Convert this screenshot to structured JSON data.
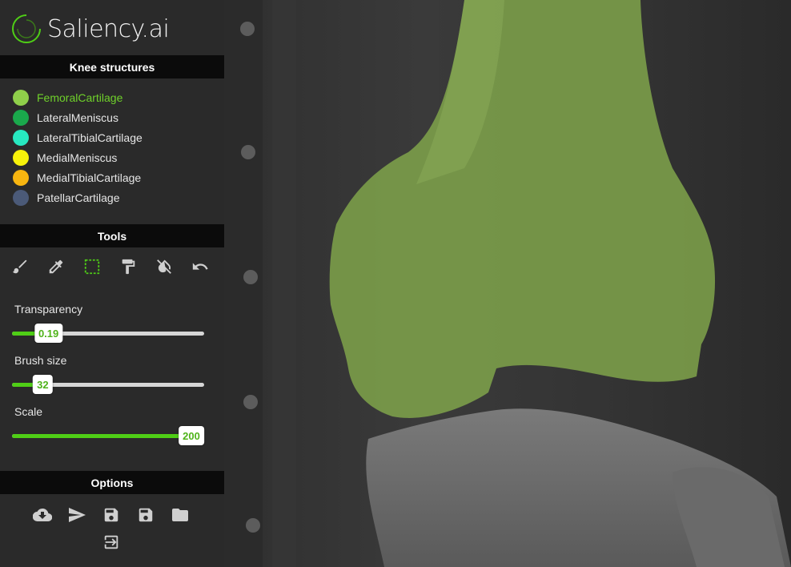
{
  "app": {
    "logo_text": "Saliency.ai"
  },
  "structures": {
    "header": "Knee structures",
    "items": [
      {
        "label": "FemoralCartilage",
        "color": "#8fcf4a",
        "active": true
      },
      {
        "label": "LateralMeniscus",
        "color": "#1aa84c",
        "active": false
      },
      {
        "label": "LateralTibialCartilage",
        "color": "#27e8c0",
        "active": false
      },
      {
        "label": "MedialMeniscus",
        "color": "#f7f20a",
        "active": false
      },
      {
        "label": "MedialTibialCartilage",
        "color": "#f7b510",
        "active": false
      },
      {
        "label": "PatellarCartilage",
        "color": "#4b5a78",
        "active": false
      }
    ]
  },
  "tools": {
    "header": "Tools",
    "items": [
      "brush-icon",
      "eyedropper-icon",
      "selection-icon",
      "paint-roller-icon",
      "fill-off-icon",
      "undo-icon"
    ],
    "active": "selection-icon"
  },
  "sliders": {
    "transparency": {
      "label": "Transparency",
      "value": "0.19",
      "fraction": 0.19
    },
    "brush_size": {
      "label": "Brush size",
      "value": "32",
      "fraction": 0.16
    },
    "scale": {
      "label": "Scale",
      "value": "200",
      "fraction": 1.0
    }
  },
  "options": {
    "header": "Options",
    "items": [
      "cloud-download-icon",
      "send-icon",
      "save-icon",
      "save-as-icon",
      "folder-icon",
      "exit-icon"
    ]
  },
  "colors": {
    "accent": "#4fce16",
    "overlay": "#8fb35a"
  }
}
